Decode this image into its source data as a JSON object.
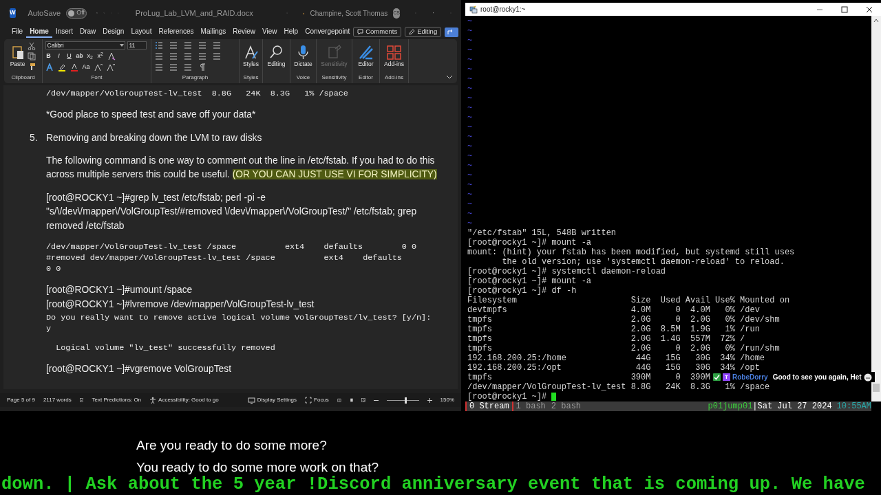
{
  "word": {
    "title_bar": {
      "logo": "W",
      "autosave_label": "AutoSave",
      "autosave_state": "Off",
      "autosave_on": false,
      "filename": "ProLug_Lab_LVM_and_RAID.docx",
      "user": "Champine, Scott Thomas",
      "avatar": "CS"
    },
    "menu_tabs": [
      {
        "label": "File",
        "selected": false
      },
      {
        "label": "Home",
        "selected": true
      },
      {
        "label": "Insert",
        "selected": false
      },
      {
        "label": "Draw",
        "selected": false
      },
      {
        "label": "Design",
        "selected": false
      },
      {
        "label": "Layout",
        "selected": false
      },
      {
        "label": "References",
        "selected": false
      },
      {
        "label": "Mailings",
        "selected": false
      },
      {
        "label": "Review",
        "selected": false
      },
      {
        "label": "View",
        "selected": false
      },
      {
        "label": "Help",
        "selected": false
      },
      {
        "label": "Convergepoint",
        "selected": false
      }
    ],
    "comments_button": "Comments",
    "editing_button": "Editing",
    "ribbon": [
      {
        "kind": "clipboard",
        "label": "Clipboard",
        "button": "Paste"
      },
      {
        "kind": "font",
        "label": "Font",
        "font_name": "Calibri",
        "font_size": "11",
        "format_buttons": [
          "B",
          "I",
          "U",
          "ab",
          "x$_{2}$",
          "x$^{2}$"
        ],
        "case_button": "Aa"
      },
      {
        "kind": "paragraph",
        "label": "Paragraph"
      },
      {
        "kind": "styles",
        "label": "Styles",
        "button": "Styles"
      },
      {
        "kind": "editing",
        "button": "Editing"
      },
      {
        "kind": "dictate",
        "label": "Voice",
        "button": "Dictate"
      },
      {
        "kind": "sensitivity",
        "label": "Sensitivity",
        "button": "Sensitivity",
        "disabled": true
      },
      {
        "kind": "editor",
        "label": "Editor",
        "button": "Editor"
      },
      {
        "kind": "addins",
        "label": "Add-ins",
        "button": "Add-ins"
      }
    ],
    "document": [
      {
        "kind": "mono",
        "lines": [
          "/dev/mapper/VolGroupTest-lv_test  8.8G   24K  8.3G   1% /space"
        ]
      },
      {
        "kind": "para",
        "text": "*Good place to speed test and save off your data*"
      },
      {
        "kind": "numbered",
        "number": "5.",
        "text": "Removing and breaking down the LVM to raw disks"
      },
      {
        "kind": "para",
        "text": "The following command is one way to comment out the line in /etc/fstab. If you had to do this across multiple servers this could be useful.",
        "highlight": "(OR YOU CAN JUST USE VI FOR SIMPLICITY)"
      },
      {
        "kind": "para",
        "text": "[root@ROCKY1 ~]#grep lv_test /etc/fstab; perl -pi -e \"s/\\/dev\\/mapper\\/VolGroupTest/#removed \\/dev\\/mapper\\/VolGroupTest/\" /etc/fstab; grep removed /etc/fstab"
      },
      {
        "kind": "mono",
        "lines": [
          "/dev/mapper/VolGroupTest-lv_test /space          ext4    defaults        0 0",
          "#removed dev/mapper/VolGroupTest-lv_test /space          ext4    defaults",
          "0 0"
        ]
      },
      {
        "kind": "para",
        "text": "[root@ROCKY1 ~]#umount /space"
      },
      {
        "kind": "command",
        "text": "[root@ROCKY1 ~]#lvremove /dev/mapper/VolGroupTest-lv_test"
      },
      {
        "kind": "mono_tight",
        "lines": [
          "Do you really want to remove active logical volume VolGroupTest/lv_test? [y/n]:",
          "y"
        ]
      },
      {
        "kind": "mono",
        "lines": [
          "  Logical volume \"lv_test\" successfully removed"
        ]
      },
      {
        "kind": "para",
        "text": "[root@ROCKY1 ~]#vgremove VolGroupTest"
      }
    ],
    "status_bar": {
      "page": "Page 5 of 9",
      "words": "2117 words",
      "text_predictions": "Text Predictions: On",
      "accessibility": "Accessibility: Good to go",
      "display_settings": "Display Settings",
      "focus": "Focus",
      "zoom": "150%",
      "zoom_slider": {
        "level": 0.55
      }
    }
  },
  "terminal": {
    "title": "root@rocky1:~",
    "tilde_lines": [
      "~",
      "~",
      "~",
      "~",
      "~",
      "~",
      "~",
      "~",
      "~",
      "~",
      "~",
      "~",
      "~",
      "~",
      "~",
      "~",
      "~",
      "~",
      "~",
      "~",
      "~",
      "~"
    ],
    "lines": [
      "\"/etc/fstab\" 15L, 548B written",
      "[root@rocky1 ~]# mount -a",
      "mount: (hint) your fstab has been modified, but systemd still uses",
      "       the old version; use 'systemctl daemon-reload' to reload.",
      "[root@rocky1 ~]# systemctl daemon-reload",
      "[root@rocky1 ~]# mount -a",
      "[root@rocky1 ~]# df -h",
      "Filesystem                       Size  Used Avail Use% Mounted on",
      "devtmpfs                         4.0M     0  4.0M   0% /dev",
      "tmpfs                            2.0G     0  2.0G   0% /dev/shm",
      "tmpfs                            2.0G  8.5M  1.9G   1% /run",
      "tmpfs                            2.0G  1.4G  557M  72% /",
      "tmpfs                            2.0G     0  2.0G   0% /run/shm",
      "192.168.200.25:/home              44G   15G   30G  34% /home",
      "192.168.200.25:/opt               44G   15G   30G  34% /opt",
      "tmpfs                            390M     0  390M",
      "/dev/mapper/VolGroupTest-lv_test 8.8G   24K  8.3G   1% /space"
    ],
    "prompt": "[root@rocky1 ~]# ",
    "chat_overlay": {
      "badge": "T",
      "user": "RobeDorry",
      "message": "Good to see you again, Het"
    },
    "tmux_windows": [
      {
        "label": "0 Stream",
        "selected": true
      },
      {
        "label": "1 bash",
        "selected": false
      },
      {
        "label": "2 bash",
        "selected": false
      }
    ],
    "host": "p01jump01",
    "date": "|Sat Jul 27 2024",
    "time": "10:55AM"
  },
  "subtitles": [
    "Are you ready to do some more?",
    "You ready to do some more work on that?"
  ],
  "ticker": "down. | Ask about the 5 year !Discord anniversary event that is coming up. We have"
}
